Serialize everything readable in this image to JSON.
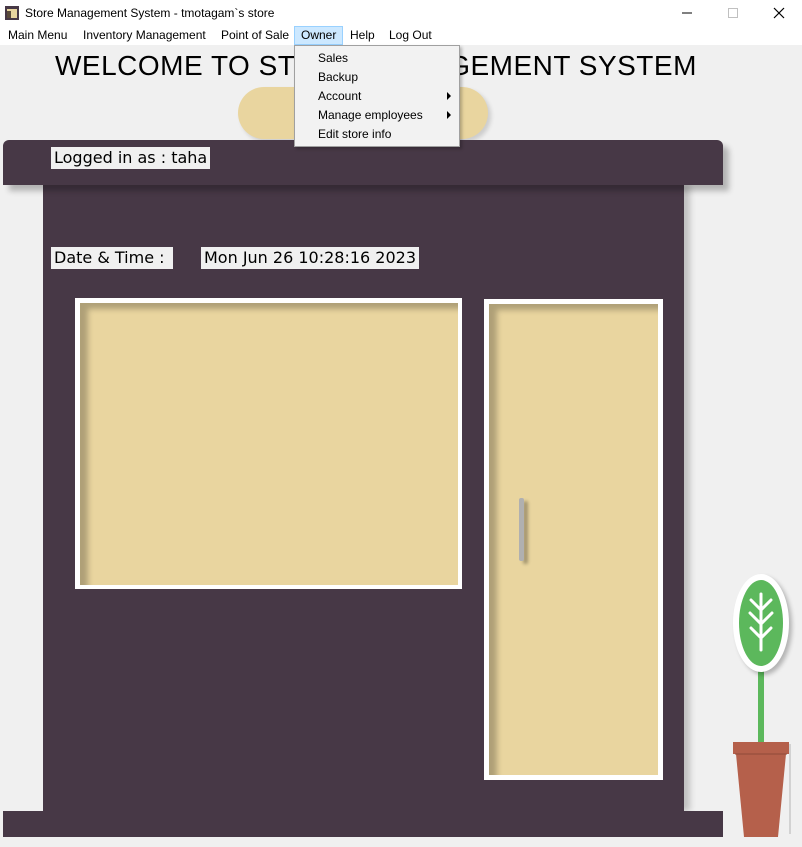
{
  "window": {
    "title": "Store Management System - tmotagam`s store"
  },
  "menu": {
    "items": [
      {
        "label": "Main Menu"
      },
      {
        "label": "Inventory Management"
      },
      {
        "label": "Point of Sale"
      },
      {
        "label": "Owner"
      },
      {
        "label": "Help"
      },
      {
        "label": "Log Out"
      }
    ],
    "active": "Owner"
  },
  "owner_menu": {
    "items": [
      {
        "label": "Sales"
      },
      {
        "label": "Backup"
      },
      {
        "label": "Account",
        "submenu": true
      },
      {
        "label": "Manage employees",
        "submenu": true
      },
      {
        "label": "Edit store info"
      }
    ]
  },
  "main": {
    "welcome": "WELCOME TO STORE MANAGEMENT SYSTEM",
    "logged_in_label": "Logged in as :  taha",
    "datetime_label": "Date & Time :",
    "datetime_value": "Mon Jun 26 10:28:16 2023"
  },
  "colors": {
    "building": "#473846",
    "panel": "#e9d59f",
    "plant": "#5cb85c",
    "pot": "#b5604b",
    "menu_highlight": "#cce8ff"
  }
}
